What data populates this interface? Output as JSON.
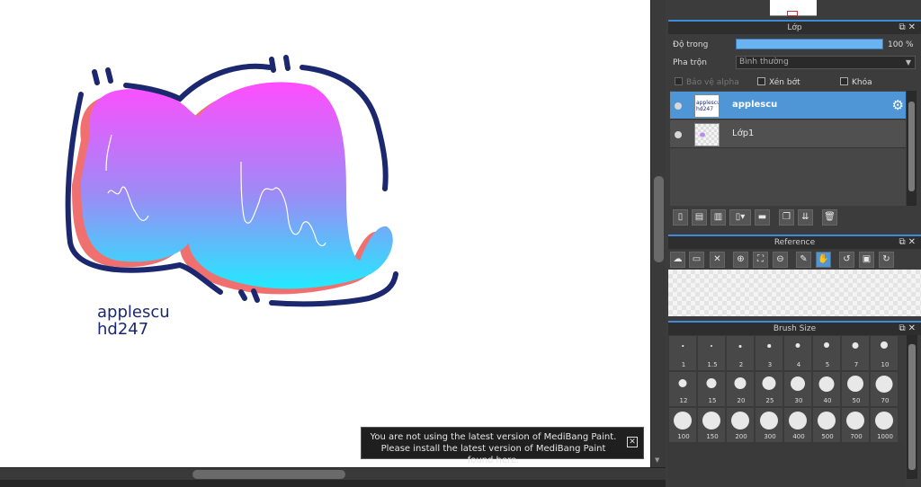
{
  "canvas": {
    "artwork_text_line1": "applescu",
    "artwork_text_line2": "hd247"
  },
  "notice": {
    "line1": "You are not using the latest version of MediBang Paint.",
    "line2": "Please install the latest version of MediBang Paint found here.",
    "close_glyph": "✕"
  },
  "layer_panel": {
    "title": "Lớp",
    "opacity_label": "Độ trong",
    "opacity_value": "100 %",
    "opacity_fraction": 1.0,
    "blend_label": "Pha trộn",
    "blend_value": "Bình thường",
    "protect_alpha_label": "Bảo vệ alpha",
    "clipping_label": "Xén bớt",
    "lock_label": "Khóa",
    "layers": [
      {
        "name": "applescu",
        "selected": true,
        "thumb_text": "applescu hd247"
      },
      {
        "name": "Lớp1",
        "selected": false
      }
    ],
    "toolbar_icons": [
      "new-layer-icon",
      "new-halftone-layer-icon",
      "new-8bit-layer-icon",
      "add-layer-menu-icon",
      "folder-icon",
      "duplicate-layer-icon",
      "merge-down-icon",
      "delete-layer-icon"
    ]
  },
  "reference_panel": {
    "title": "Reference",
    "toolbar_icons": [
      "cloud-icon",
      "open-folder-icon",
      "close-icon",
      "zoom-in-icon",
      "fit-icon",
      "zoom-out-icon",
      "eyedropper-icon",
      "hand-icon",
      "rotate-left-icon",
      "fit-screen-icon",
      "rotate-right-icon"
    ]
  },
  "brush_panel": {
    "title": "Brush Size",
    "sizes": [
      "1",
      "1.5",
      "2",
      "3",
      "4",
      "5",
      "7",
      "10",
      "12",
      "15",
      "20",
      "25",
      "30",
      "40",
      "50",
      "70",
      "100",
      "150",
      "200",
      "300",
      "400",
      "500",
      "700",
      "1000"
    ]
  },
  "colors": {
    "accent": "#4f96d6",
    "art_outline": "#1b2870",
    "gradient_top": "#ff4dff",
    "gradient_bottom": "#22eaff",
    "shadow": "#f07070"
  }
}
